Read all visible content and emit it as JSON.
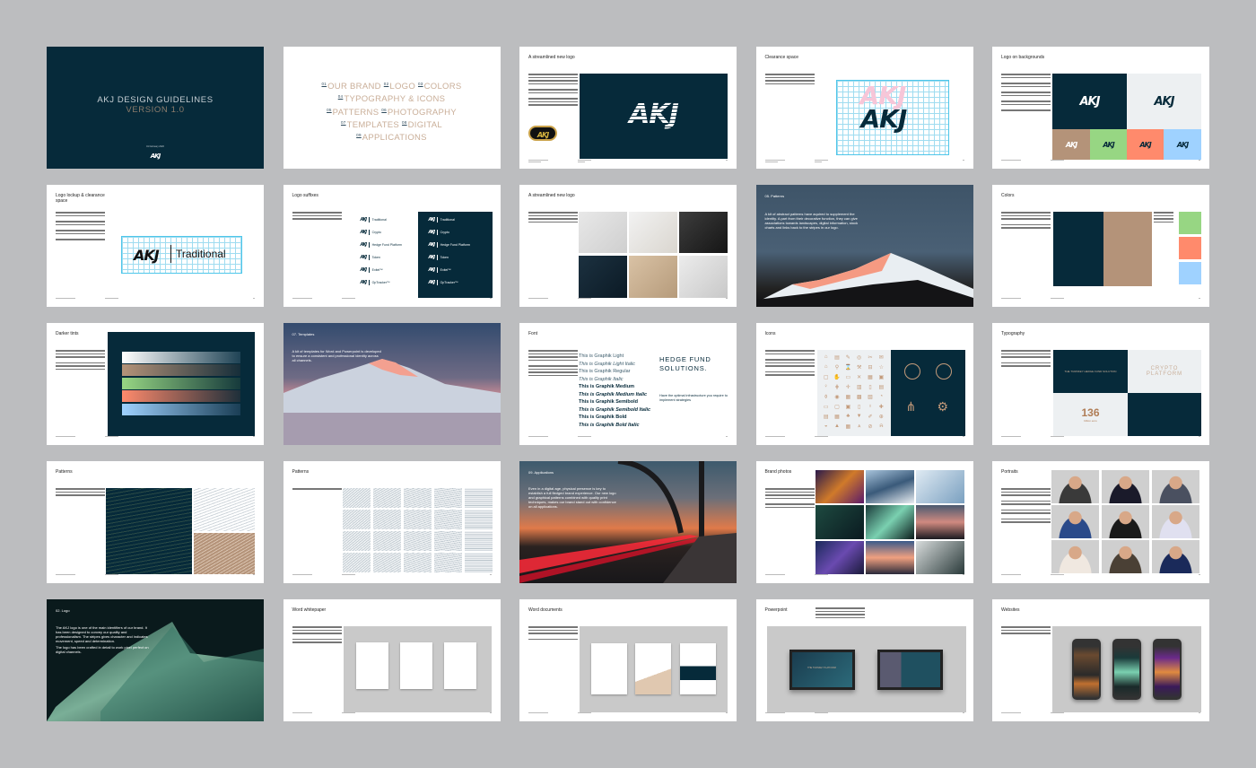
{
  "brand": {
    "logo": "AKJ",
    "primary": "#062a3a",
    "accent": "#c9ae98",
    "green": "#97d683",
    "coral": "#ff8a6c",
    "blue": "#9fd2ff",
    "light": "#edf0f2"
  },
  "slides": {
    "cover": {
      "title": "AKJ DESIGN GUIDELINES",
      "version": "VERSION 1.0",
      "date": "01 February 2020",
      "logo": "AKJ"
    },
    "toc": {
      "items": [
        {
          "num": "01",
          "label": "OUR BRAND"
        },
        {
          "num": "02",
          "label": "LOGO"
        },
        {
          "num": "03",
          "label": "COLORS"
        },
        {
          "num": "04",
          "label": "TYPOGRAPHY & ICONS"
        },
        {
          "num": "05",
          "label": "PATTERNS"
        },
        {
          "num": "06",
          "label": "PHOTOGRAPHY"
        },
        {
          "num": "07",
          "label": "TEMPLATES"
        },
        {
          "num": "08",
          "label": "DIGITAL"
        },
        {
          "num": "09",
          "label": "APPLICATIONS"
        }
      ]
    },
    "new_logo": {
      "title": "A streamlined new logo"
    },
    "clearance": {
      "title": "Clearance space"
    },
    "backgrounds": {
      "title": "Logo on backgrounds"
    },
    "lockup": {
      "title": "Logo lockup & clearance space",
      "suffix": "Traditional"
    },
    "suffixes": {
      "title": "Logo suffixes",
      "items": [
        "Traditional",
        "Crypto",
        "Hedge Fund Platform",
        "Token",
        "Exitel™",
        "OpTracker™"
      ]
    },
    "new_logo_2": {
      "title": "A streamlined new logo"
    },
    "patterns_intro": {
      "section": "05. Patterns",
      "text": "A kit of abstract patterns have aquired to supplement the identity. A part from their decorative function, they can give associations towards landscapes, digital information, stock charts and links back to the stripes in our logo."
    },
    "colors": {
      "title": "Colors"
    },
    "tints": {
      "title": "Darker tints"
    },
    "templates_intro": {
      "section": "07. Templates",
      "text": "A kit of templates for Word and Powerpoint is developed to ensure a consistent and professional identity across all channels."
    },
    "font": {
      "title": "Font",
      "samples": [
        "This is Graphik Light",
        "This is Graphik Light Italic",
        "This is Graphik Regular",
        "This is Graphik Italic",
        "This is Graphik Medium",
        "This is Graphik Medium Italic",
        "This is Graphik Semibold",
        "This is Graphik Semibold Italic",
        "This is Graphik Bold",
        "This is Graphik Bold Italic"
      ],
      "headline": "HEDGE FUND SOLUTIONS.",
      "subhead": "Have the optimal infrastructure you require to implement strategies"
    },
    "icons": {
      "title": "Icons"
    },
    "typography": {
      "title": "Typography",
      "tile1": "THE TURNKEY HEDGE FUND SOLUTION",
      "tile2": "CRYPTO PLATFORM",
      "number": "136",
      "number_label": "billion euro"
    },
    "patterns": {
      "title": "Patterns"
    },
    "patterns_2": {
      "title": "Patterns"
    },
    "applications_intro": {
      "section": "09. Applications",
      "text": "Even in a digital age, physical presence is key to establish a full fledged brand experience. Our new logo and graphical patterns combined with quality print techniques, makes our brand stand out with confidence on all applications."
    },
    "brand_photos": {
      "title": "Brand photos"
    },
    "portraits": {
      "title": "Portraits"
    },
    "logo_intro": {
      "section": "02. Logo",
      "text1": "The AKJ logo is one of the main identifiers of our brand. It has been designed to convey our quality and professionalism. The stripes gives character and indicates movement, speed and determination.",
      "text2": "The logo has been crafted in detail to work pixel perfect on digital channels."
    },
    "whitepaper": {
      "title": "Word whitepaper"
    },
    "word_docs": {
      "title": "Word documents"
    },
    "powerpoint": {
      "title": "Powerpoint",
      "screen_title": "THE TURNKEY PLATFORM"
    },
    "websites": {
      "title": "Websites"
    }
  }
}
